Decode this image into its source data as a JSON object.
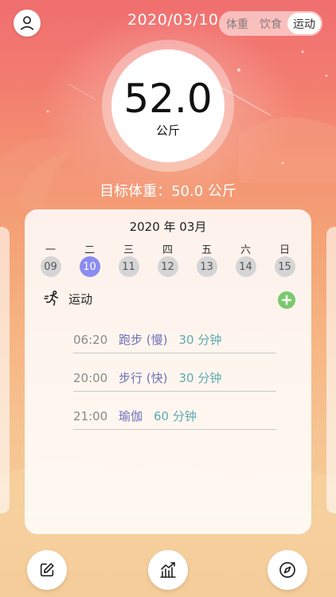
{
  "header": {
    "date": "2020/03/10",
    "tabs": [
      {
        "label": "体重",
        "active": false
      },
      {
        "label": "饮食",
        "active": false
      },
      {
        "label": "运动",
        "active": true
      }
    ]
  },
  "weight": {
    "value": "52.0",
    "unit": "公斤",
    "target": "目标体重：50.0 公斤"
  },
  "calendar": {
    "month": "2020 年 03月",
    "weekdays": [
      "一",
      "二",
      "三",
      "四",
      "五",
      "六",
      "日"
    ],
    "days": [
      "09",
      "10",
      "11",
      "12",
      "13",
      "14",
      "15"
    ],
    "selected_day": "10"
  },
  "exercise": {
    "label": "运动",
    "entries": [
      {
        "time": "06:20",
        "activity": "跑步 (慢)",
        "duration": "30 分钟"
      },
      {
        "time": "20:00",
        "activity": "步行 (快)",
        "duration": "30 分钟"
      },
      {
        "time": "21:00",
        "activity": "瑜伽",
        "duration": "60 分钟"
      }
    ]
  },
  "colors": {
    "accent": "#8b8cf2",
    "add": "#7bc96f",
    "activity_text": "#6e6fb9",
    "duration_text": "#5eaab0"
  },
  "icons": {
    "profile": "person-icon",
    "add": "plus-icon",
    "exercise": "running-icon",
    "edit": "edit-icon",
    "chart": "chart-icon",
    "compass": "compass-icon"
  }
}
